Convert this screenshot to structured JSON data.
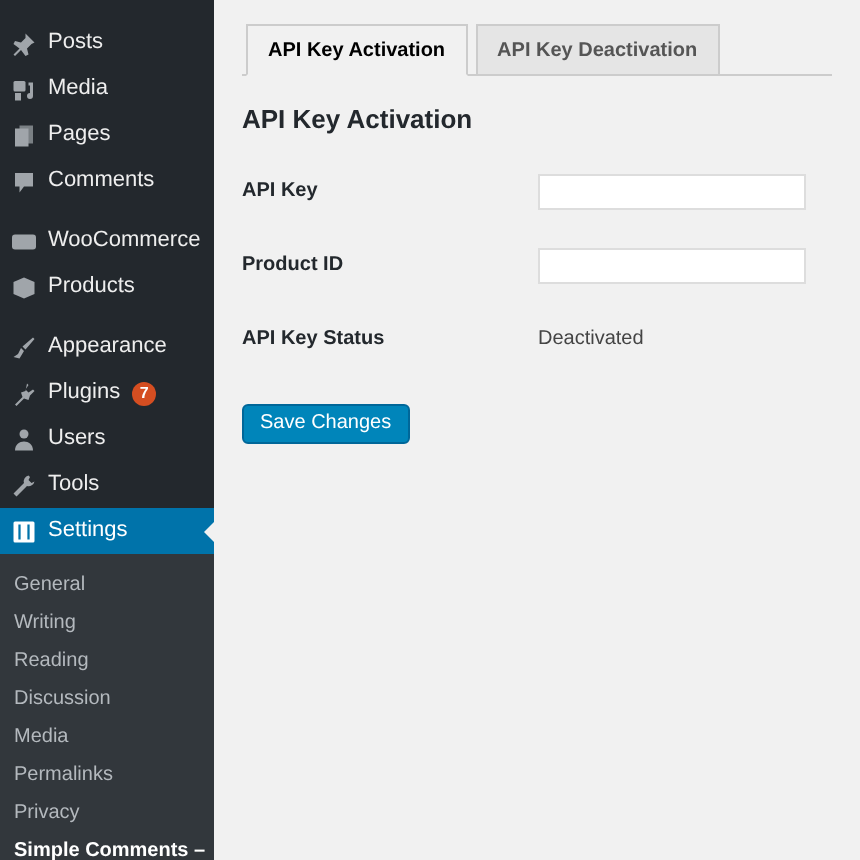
{
  "sidebar": {
    "items": [
      {
        "label": "Posts",
        "selected": false
      },
      {
        "label": "Media",
        "selected": false
      },
      {
        "label": "Pages",
        "selected": false
      },
      {
        "label": "Comments",
        "selected": false
      },
      {
        "label": "WooCommerce",
        "selected": false
      },
      {
        "label": "Products",
        "selected": false
      },
      {
        "label": "Appearance",
        "selected": false
      },
      {
        "label": "Plugins",
        "selected": false,
        "badge": "7"
      },
      {
        "label": "Users",
        "selected": false
      },
      {
        "label": "Tools",
        "selected": false
      },
      {
        "label": "Settings",
        "selected": true
      }
    ],
    "submenu": [
      {
        "label": "General",
        "selected": false
      },
      {
        "label": "Writing",
        "selected": false
      },
      {
        "label": "Reading",
        "selected": false
      },
      {
        "label": "Discussion",
        "selected": false
      },
      {
        "label": "Media",
        "selected": false
      },
      {
        "label": "Permalinks",
        "selected": false
      },
      {
        "label": "Privacy",
        "selected": false
      },
      {
        "label": "Simple Comments –",
        "selected": true
      }
    ]
  },
  "tabs": [
    {
      "label": "API Key Activation",
      "selected": true
    },
    {
      "label": "API Key Deactivation",
      "selected": false
    }
  ],
  "section_title": "API Key Activation",
  "fields": [
    {
      "kind": "input",
      "label": "API Key"
    },
    {
      "kind": "input",
      "label": "Product ID"
    },
    {
      "kind": "text",
      "label": "API Key Status",
      "value": "Deactivated"
    }
  ],
  "save_button": "Save Changes"
}
